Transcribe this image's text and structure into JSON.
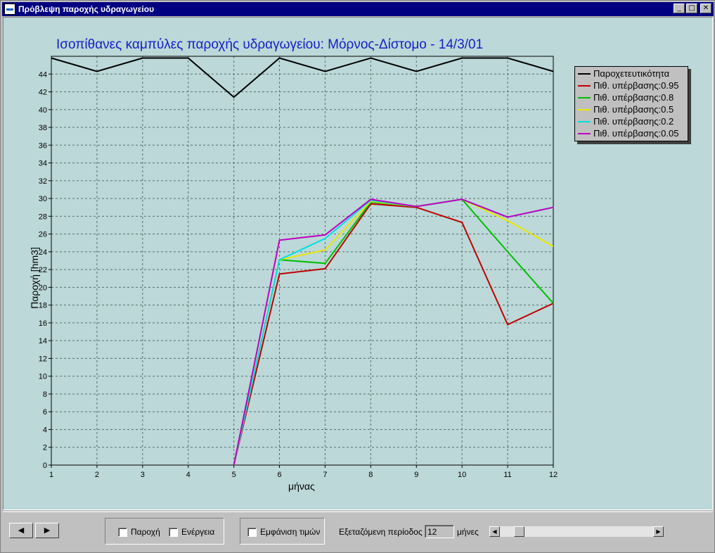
{
  "window": {
    "title": "Πρόβλεψη παροχής υδραγωγείου"
  },
  "chart": {
    "title": "Ισοπίθανες καμπύλες παροχής υδραγωγείου: Μόρνος-Δίστομο - 14/3/01",
    "xlabel": "μήνας",
    "ylabel": "Παροχή [hm3]"
  },
  "chart_data": {
    "type": "line",
    "title": "Ισοπίθανες καμπύλες παροχής υδραγωγείου: Μόρνος-Δίστομο - 14/3/01",
    "xlabel": "μήνας",
    "ylabel": "Παροχή [hm3]",
    "xlim": [
      1,
      12
    ],
    "ylim": [
      0,
      46
    ],
    "x_ticks": [
      1,
      2,
      3,
      4,
      5,
      6,
      7,
      8,
      9,
      10,
      11,
      12
    ],
    "y_ticks": [
      0,
      2,
      4,
      6,
      8,
      10,
      12,
      14,
      16,
      18,
      20,
      22,
      24,
      26,
      28,
      30,
      32,
      34,
      36,
      38,
      40,
      42,
      44
    ],
    "grid": true,
    "legend_position": "right",
    "series": [
      {
        "name": "Παροχετευτικότητα",
        "color": "#000000",
        "x": [
          1,
          2,
          3,
          4,
          5,
          6,
          7,
          8,
          9,
          10,
          11,
          12
        ],
        "y": [
          45.8,
          44.3,
          45.8,
          45.8,
          41.4,
          45.8,
          44.3,
          45.8,
          44.3,
          45.8,
          45.8,
          44.3
        ]
      },
      {
        "name": "Πιθ. υπέρβασης:0.95",
        "color": "#c00000",
        "x": [
          5,
          6,
          7,
          8,
          9,
          10,
          11,
          12
        ],
        "y": [
          0,
          21.5,
          22.1,
          29.4,
          29.0,
          27.3,
          15.8,
          18.2
        ]
      },
      {
        "name": "Πιθ. υπέρβασης:0.8",
        "color": "#00c000",
        "x": [
          5,
          6,
          7,
          8,
          9,
          10,
          11,
          12
        ],
        "y": [
          0,
          23.1,
          22.7,
          29.6,
          29.1,
          29.9,
          24.0,
          18.2
        ]
      },
      {
        "name": "Πιθ. υπέρβασης:0.5",
        "color": "#e8e800",
        "x": [
          5,
          6,
          7,
          8,
          9,
          10,
          11,
          12
        ],
        "y": [
          0,
          23.1,
          24.2,
          29.7,
          29.1,
          29.9,
          27.5,
          24.6
        ]
      },
      {
        "name": "Πιθ. υπέρβασης:0.2",
        "color": "#00e0e0",
        "x": [
          5,
          6,
          7,
          8,
          9,
          10,
          11,
          12
        ],
        "y": [
          0,
          23.1,
          25.5,
          29.8,
          29.1,
          29.9,
          27.9,
          29.0
        ]
      },
      {
        "name": "Πιθ. υπέρβασης:0.05",
        "color": "#c000c0",
        "x": [
          5,
          6,
          7,
          8,
          9,
          10,
          11,
          12
        ],
        "y": [
          0,
          25.3,
          25.9,
          29.9,
          29.1,
          29.9,
          27.9,
          29.0
        ]
      }
    ]
  },
  "controls": {
    "prev_icon": "◀",
    "next_icon": "▶",
    "flow_label": "Παροχή",
    "energy_label": "Ενέργεια",
    "show_values_label": "Εμφάνιση τιμών",
    "period_label": "Εξεταζόμενη περίοδος :",
    "period_value": "12",
    "period_unit": "μήνες",
    "scroll_left": "◀",
    "scroll_right": "▶",
    "scroll_fraction": 0.1
  }
}
